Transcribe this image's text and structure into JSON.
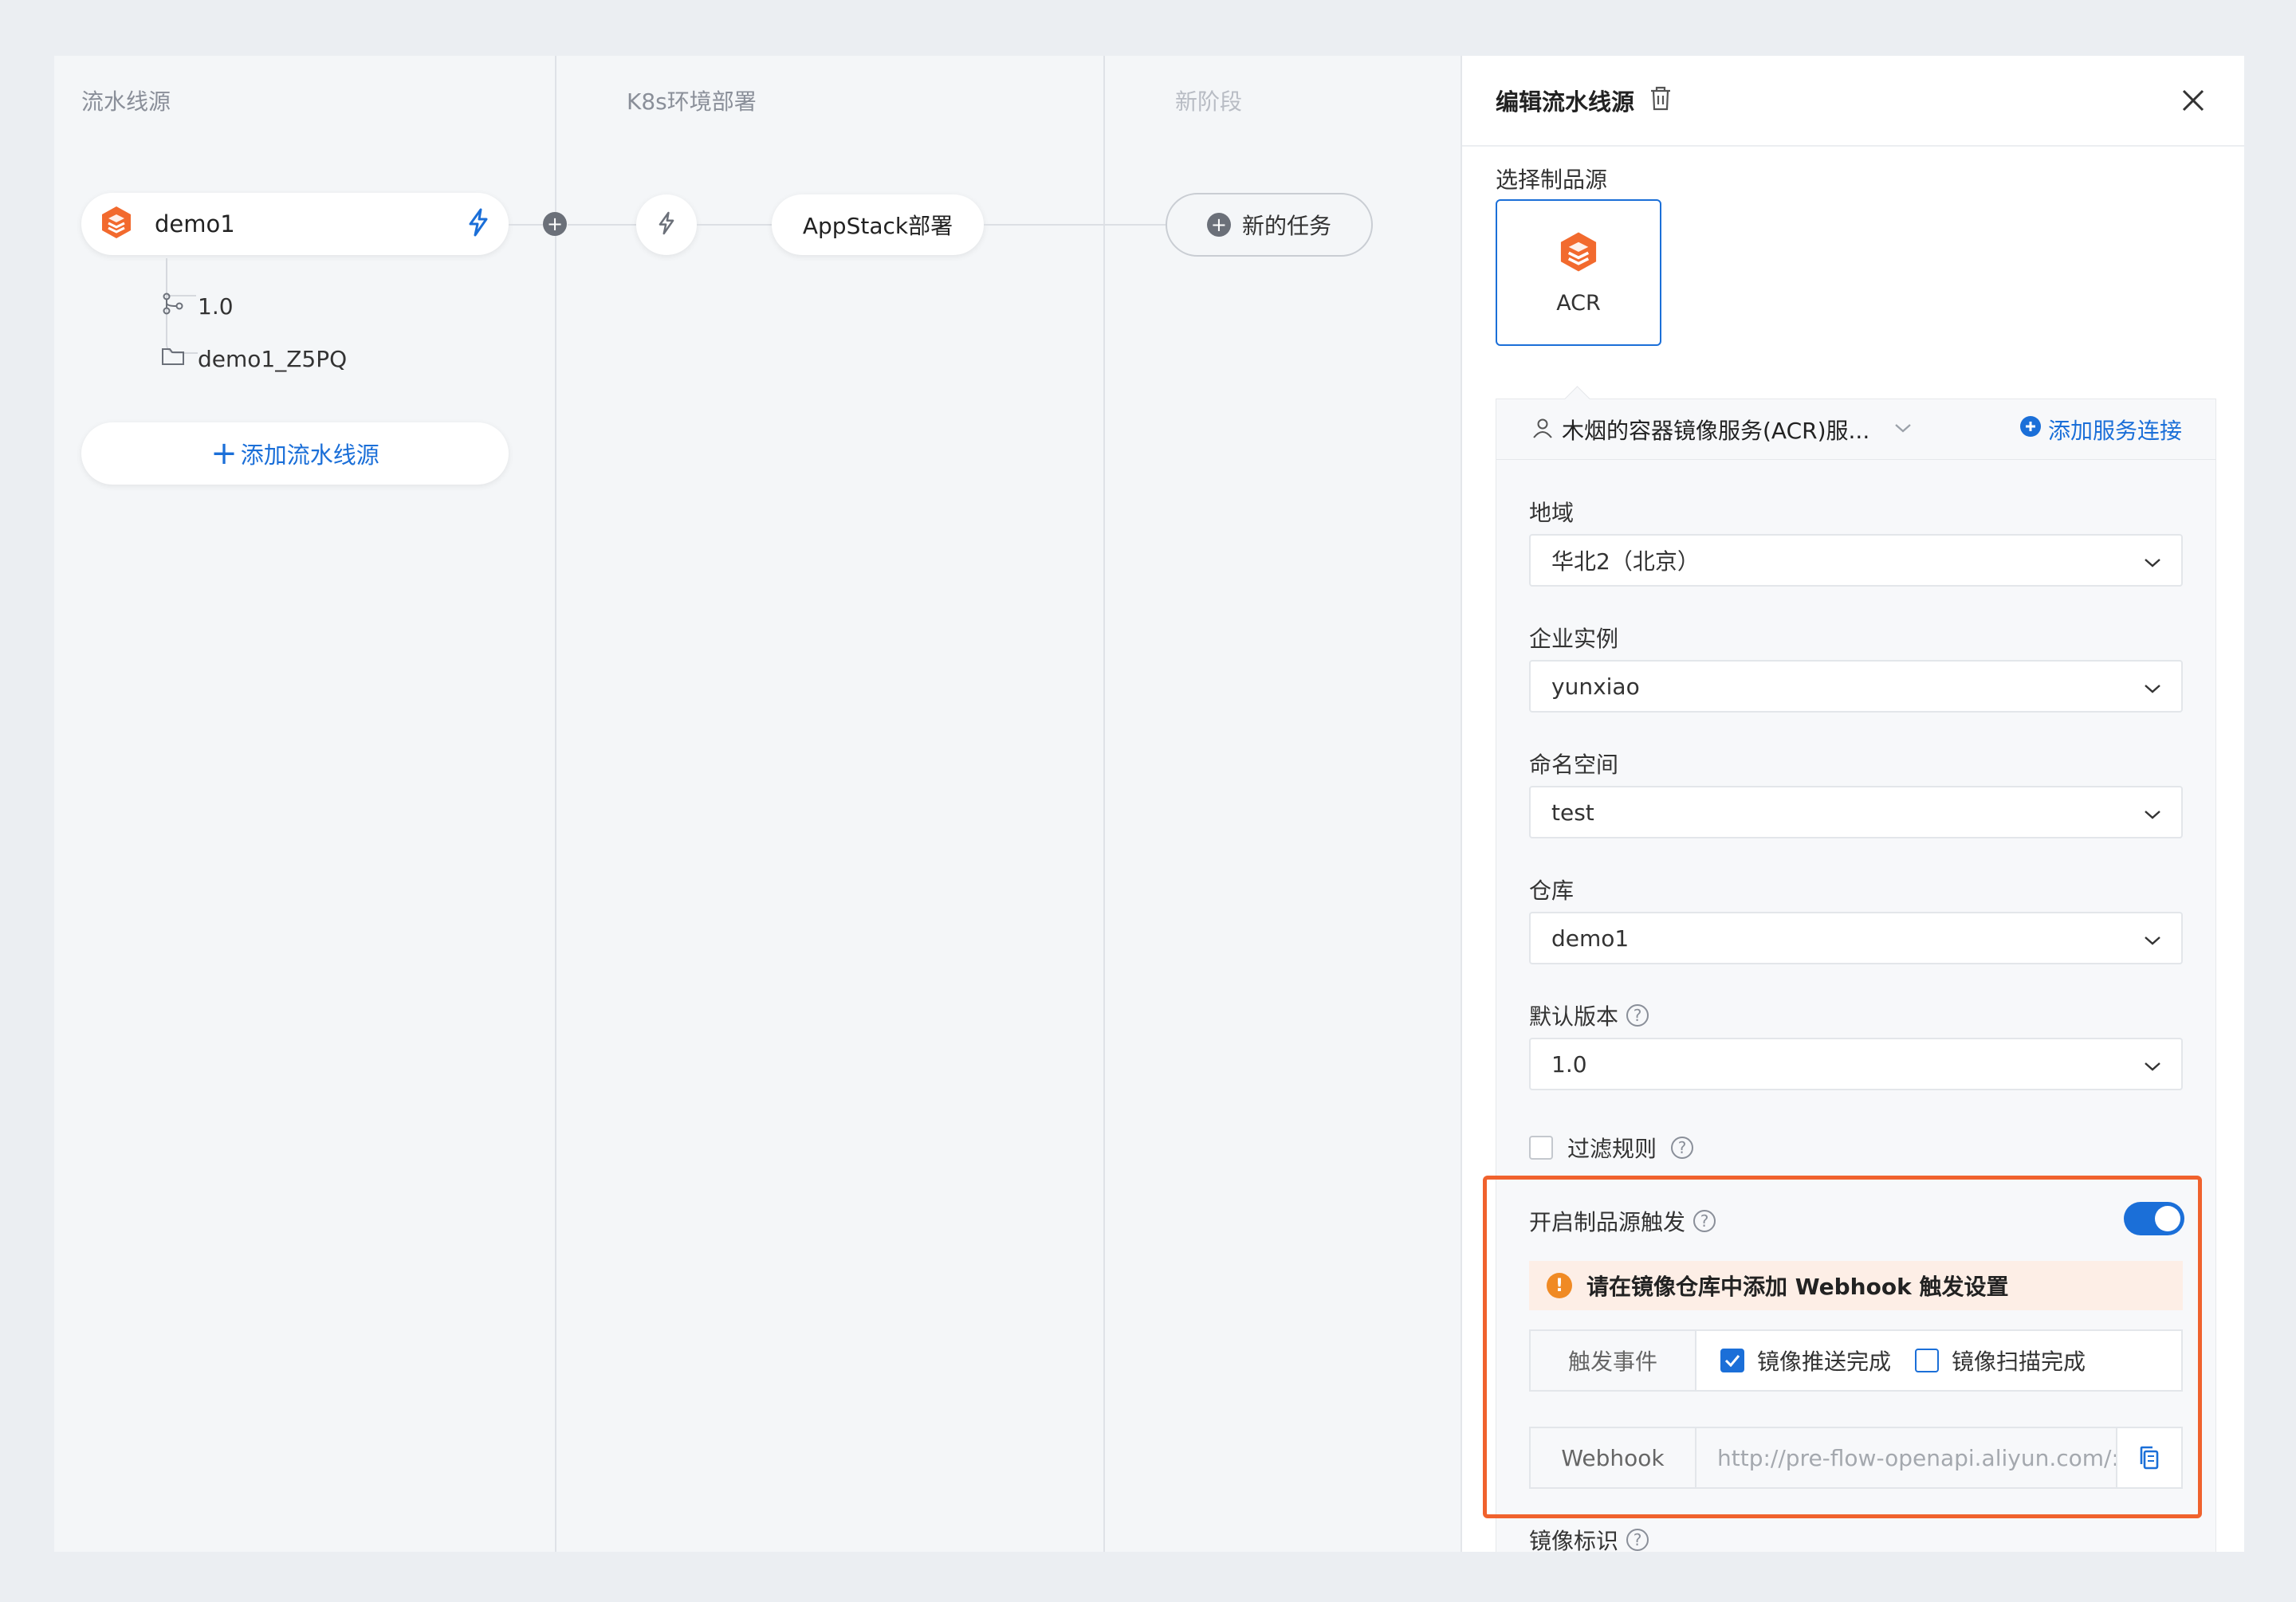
{
  "columns": {
    "sources": "流水线源",
    "stage1": "K8s环境部署",
    "stage2": "新阶段"
  },
  "source_card": {
    "name": "demo1"
  },
  "tree": {
    "branch": "1.0",
    "repo": "demo1_Z5PQ"
  },
  "add_source_label": "添加流水线源",
  "job_label": "AppStack部署",
  "new_task_label": "新的任务",
  "panel": {
    "title": "编辑流水线源",
    "select_source_label": "选择制品源",
    "acr_label": "ACR",
    "service_name": "木烟的容器镜像服务(ACR)服...",
    "add_service_label": "添加服务连接",
    "fields": {
      "region_label": "地域",
      "region_value": "华北2（北京）",
      "instance_label": "企业实例",
      "instance_value": "yunxiao",
      "namespace_label": "命名空间",
      "namespace_value": "test",
      "repo_label": "仓库",
      "repo_value": "demo1",
      "version_label": "默认版本",
      "version_value": "1.0"
    },
    "filter_label": "过滤规则",
    "trigger_label": "开启制品源触发",
    "warning_text": "请在镜像仓库中添加 Webhook 触发设置",
    "trigger_event_label": "触发事件",
    "event_push": "镜像推送完成",
    "event_scan": "镜像扫描完成",
    "webhook_label": "Webhook",
    "webhook_url": "http://pre-flow-openapi.aliyun.com/:",
    "image_tag_label": "镜像标识"
  },
  "colors": {
    "accent": "#1b6fd8",
    "highlight": "#f0622d",
    "acr_orange": "#f26a2e"
  }
}
